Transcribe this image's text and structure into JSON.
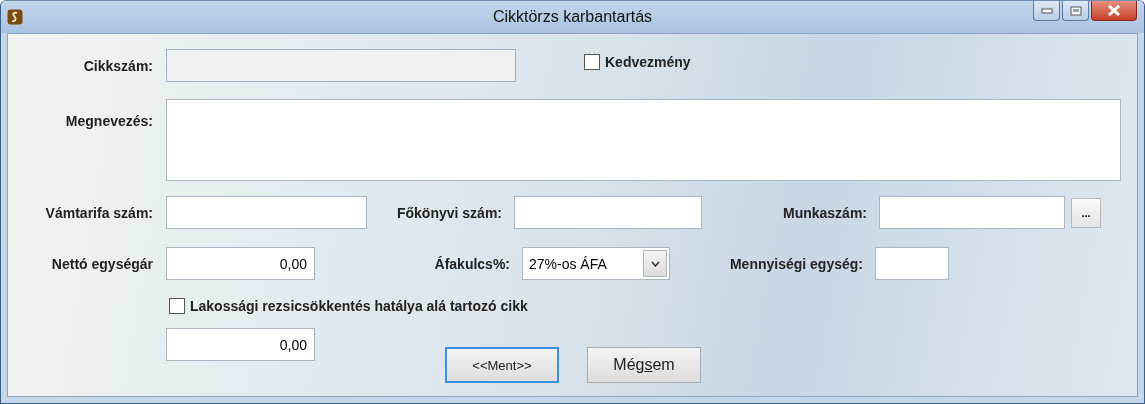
{
  "window": {
    "title": "Cikktörzs karbantartás"
  },
  "fields": {
    "cikkszam": {
      "label": "Cikkszám:",
      "disabled": true
    },
    "kedvezmeny": {
      "label": "Kedvezmény",
      "checked": false
    },
    "megnevezes": {
      "label": "Megnevezés:"
    },
    "vamtarifa": {
      "label": "Vámtarifa szám:"
    },
    "fokonyvi": {
      "label": "Főkönyvi szám:"
    },
    "munkaszam": {
      "label": "Munkaszám:",
      "browse_button": "..."
    },
    "netto": {
      "label": "Nettó egységár",
      "value": "0,00"
    },
    "afakulcs": {
      "label": "Áfakulcs%:",
      "value": "27%-os ÁFA"
    },
    "mennyisegi": {
      "label": "Mennyiségi egység:"
    },
    "lakossagi": {
      "label": "Lakossági rezsicsökkentés hatálya alá tartozó cikk",
      "checked": false
    },
    "extra_amount": {
      "value": "0,00"
    }
  },
  "buttons": [
    {
      "label": "<<Ment>>",
      "focused": true
    },
    {
      "label_start": "Még",
      "mnemonic": "s",
      "label_end": "em",
      "focused": false
    }
  ]
}
